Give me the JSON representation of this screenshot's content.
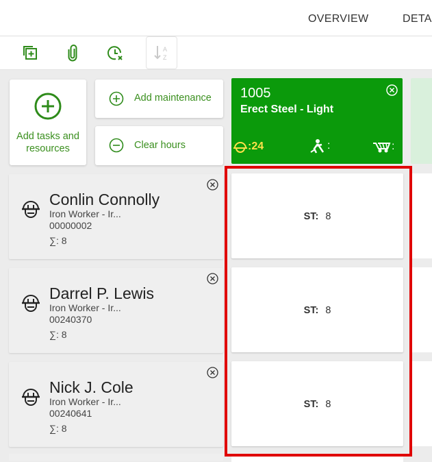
{
  "tabs": [
    {
      "label": "OVERVIEW"
    },
    {
      "label": "DETA"
    }
  ],
  "toolbar": {
    "icons": [
      "add-copy-icon",
      "paperclip-icon",
      "clock-cancel-icon",
      "sort-az-icon"
    ]
  },
  "actions": {
    "add_tasks_label": "Add tasks and resources",
    "add_maintenance_label": "Add maintenance",
    "clear_hours_label": "Clear hours"
  },
  "task": {
    "number": "1005",
    "name": "Erect Steel - Light",
    "worker_count": ":24",
    "equipment_count": ":",
    "material_count": ":"
  },
  "resources": [
    {
      "name": "Conlin Connolly",
      "role": "Iron Worker - Ir...",
      "id": "00000002",
      "sum": ": 8"
    },
    {
      "name": "Darrel P. Lewis",
      "role": "Iron Worker - Ir...",
      "id": "00240370",
      "sum": ": 8"
    },
    {
      "name": "Nick J. Cole",
      "role": "Iron Worker - Ir...",
      "id": "00240641",
      "sum": ": 8"
    }
  ],
  "hours": [
    {
      "label": "ST:",
      "value": "8"
    },
    {
      "label": "ST:",
      "value": "8"
    },
    {
      "label": "ST:",
      "value": "8"
    }
  ],
  "colors": {
    "accent_green": "#3a8f1e",
    "task_green": "#0b9a0b",
    "task_count_yellow": "#ffe14a",
    "selection_red": "#e00000"
  }
}
